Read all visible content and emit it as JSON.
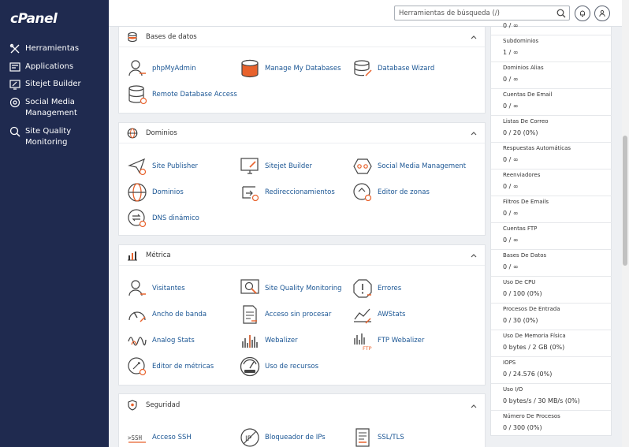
{
  "brand": {
    "logo": "cPanel"
  },
  "sidebar": {
    "items": [
      {
        "label": "Herramientas",
        "icon": "tools-icon"
      },
      {
        "label": "Applications",
        "icon": "apps-icon"
      },
      {
        "label": "Sitejet Builder",
        "icon": "sitejet-icon"
      },
      {
        "label": "Social Media Management",
        "icon": "social-icon"
      },
      {
        "label": "Site Quality Monitoring",
        "icon": "quality-icon"
      }
    ]
  },
  "header": {
    "search_placeholder": "Herramientas de búsqueda (/)"
  },
  "sections": {
    "databases": {
      "title": "Bases de datos",
      "items": [
        "phpMyAdmin",
        "Manage My Databases",
        "Database Wizard",
        "Remote Database Access"
      ]
    },
    "domains": {
      "title": "Dominios",
      "items": [
        "Site Publisher",
        "Sitejet Builder",
        "Social Media Management",
        "Dominios",
        "Redireccionamientos",
        "Editor de zonas",
        "DNS dinámico"
      ]
    },
    "metrics": {
      "title": "Métrica",
      "items": [
        "Visitantes",
        "Site Quality Monitoring",
        "Errores",
        "Ancho de banda",
        "Acceso sin procesar",
        "AWStats",
        "Analog Stats",
        "Webalizer",
        "FTP Webalizer",
        "Editor de métricas",
        "Uso de recursos"
      ]
    },
    "security": {
      "title": "Seguridad",
      "items": [
        "Acceso SSH",
        "Bloqueador de IPs",
        "SSL/TLS"
      ]
    }
  },
  "stats": [
    {
      "label": "",
      "value": "0 / ∞"
    },
    {
      "label": "Subdominios",
      "value": "1 / ∞"
    },
    {
      "label": "Dominios Alias",
      "value": "0 / ∞"
    },
    {
      "label": "Cuentas De Email",
      "value": "0 / ∞"
    },
    {
      "label": "Listas De Correo",
      "value": "0 / 20   (0%)"
    },
    {
      "label": "Respuestas Automáticas",
      "value": "0 / ∞"
    },
    {
      "label": "Reenviadores",
      "value": "0 / ∞"
    },
    {
      "label": "Filtros De Emails",
      "value": "0 / ∞"
    },
    {
      "label": "Cuentas FTP",
      "value": "0 / ∞"
    },
    {
      "label": "Bases De Datos",
      "value": "0 / ∞"
    },
    {
      "label": "Uso De CPU",
      "value": "0 / 100   (0%)"
    },
    {
      "label": "Procesos De Entrada",
      "value": "0 / 30   (0%)"
    },
    {
      "label": "Uso De Memoria Física",
      "value": "0 bytes / 2 GB   (0%)"
    },
    {
      "label": "IOPS",
      "value": "0 / 24.576   (0%)"
    },
    {
      "label": "Uso I/O",
      "value": "0 bytes/s / 30 MB/s   (0%)"
    },
    {
      "label": "Número De Procesos",
      "value": "0 / 300   (0%)"
    }
  ],
  "colors": {
    "sidebar": "#1f2a4f",
    "link": "#1b5694",
    "accent": "#e8622c"
  }
}
